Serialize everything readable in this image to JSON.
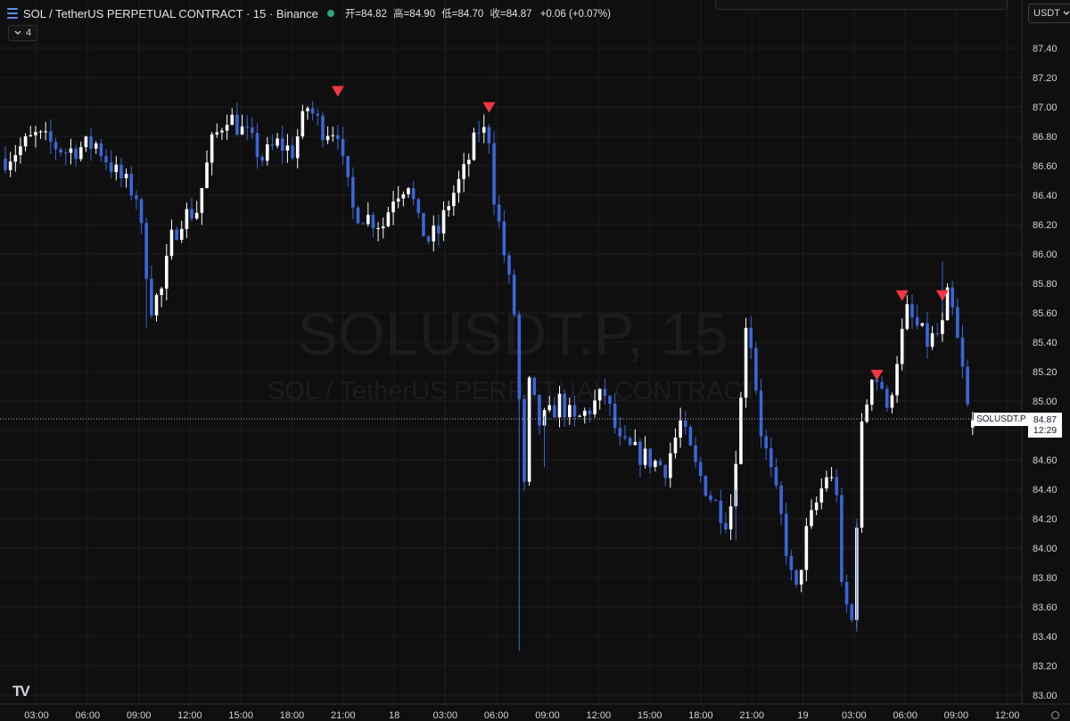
{
  "header": {
    "title": "SOL / TetherUS PERPETUAL CONTRACT · 15 · Binance",
    "open_label": "开",
    "open": "=84.82",
    "high_label": "高",
    "high": "=84.90",
    "low_label": "低",
    "low": "=84.70",
    "close_label": "收",
    "close": "=84.87",
    "change": "+0.06 (+0.07%)"
  },
  "indicator_toggle": {
    "count": "4",
    "chevron": "chevron-down-icon"
  },
  "currency": {
    "label": "USDT",
    "chevron": "chevron-down-icon"
  },
  "watermark": {
    "line1": "SOLUSDT.P, 15",
    "line2": "SOL / TetherUS PERPETUAL CONTRACT"
  },
  "last_price": {
    "symbol": "SOLUSDT.P",
    "price": "84.87",
    "countdown": "12:29"
  },
  "logo": "TV",
  "colors": {
    "background": "#0f0f0f",
    "up": "#ffffff",
    "down": "#3b66d9",
    "signal": "#f23645",
    "grid": "#1c1c1c",
    "axis_text": "#d1d4dc"
  },
  "chart_data": {
    "type": "candlestick",
    "interval_minutes": 15,
    "ylim": [
      83.0,
      87.6
    ],
    "y_ticks": [
      "87.40",
      "87.20",
      "87.00",
      "86.80",
      "86.60",
      "86.40",
      "86.20",
      "86.00",
      "85.80",
      "85.60",
      "85.40",
      "85.20",
      "85.00",
      "84.80",
      "84.60",
      "84.40",
      "84.20",
      "84.00",
      "83.80",
      "83.60",
      "83.40",
      "83.20",
      "83.00"
    ],
    "x_ticks": [
      "03:00",
      "06:00",
      "09:00",
      "12:00",
      "15:00",
      "18:00",
      "21:00",
      "18",
      "03:00",
      "06:00",
      "09:00",
      "12:00",
      "15:00",
      "18:00",
      "21:00",
      "19",
      "03:00",
      "06:00",
      "09:00",
      "12:00"
    ],
    "last_close": 84.87,
    "close_path": [
      [
        0,
        86.65
      ],
      [
        6,
        86.8
      ],
      [
        12,
        86.7
      ],
      [
        18,
        86.75
      ],
      [
        22,
        86.55
      ],
      [
        26,
        86.4
      ],
      [
        28,
        85.9
      ],
      [
        29,
        85.65
      ],
      [
        31,
        85.75
      ],
      [
        33,
        86.1
      ],
      [
        35,
        86.25
      ],
      [
        38,
        86.3
      ],
      [
        41,
        86.75
      ],
      [
        44,
        86.95
      ],
      [
        48,
        86.8
      ],
      [
        51,
        86.65
      ],
      [
        54,
        86.75
      ],
      [
        57,
        86.7
      ],
      [
        60,
        87.0
      ],
      [
        63,
        86.85
      ],
      [
        66,
        86.85
      ],
      [
        67,
        86.6
      ],
      [
        69,
        86.3
      ],
      [
        72,
        86.25
      ],
      [
        75,
        86.2
      ],
      [
        77,
        86.4
      ],
      [
        80,
        86.5
      ],
      [
        82,
        86.2
      ],
      [
        84,
        86.1
      ],
      [
        86,
        86.15
      ],
      [
        88,
        86.35
      ],
      [
        91,
        86.55
      ],
      [
        94,
        86.85
      ],
      [
        96,
        86.8
      ],
      [
        97,
        86.4
      ],
      [
        99,
        86.0
      ],
      [
        101,
        85.6
      ],
      [
        102,
        85.0
      ],
      [
        103,
        84.4
      ],
      [
        104,
        85.1
      ],
      [
        106,
        84.85
      ],
      [
        108,
        84.9
      ],
      [
        110,
        85.0
      ],
      [
        113,
        84.85
      ],
      [
        116,
        84.95
      ],
      [
        119,
        85.05
      ],
      [
        122,
        84.7
      ],
      [
        125,
        84.65
      ],
      [
        128,
        84.6
      ],
      [
        131,
        84.55
      ],
      [
        134,
        84.85
      ],
      [
        137,
        84.55
      ],
      [
        140,
        84.35
      ],
      [
        141,
        84.3
      ],
      [
        143,
        84.2
      ],
      [
        144,
        84.3
      ],
      [
        146,
        85.0
      ],
      [
        147,
        85.55
      ],
      [
        148,
        85.4
      ],
      [
        150,
        84.8
      ],
      [
        152,
        84.5
      ],
      [
        154,
        84.2
      ],
      [
        155,
        84.0
      ],
      [
        156,
        83.8
      ],
      [
        157,
        83.7
      ],
      [
        159,
        84.1
      ],
      [
        161,
        84.3
      ],
      [
        163,
        84.5
      ],
      [
        165,
        84.4
      ],
      [
        166,
        83.7
      ],
      [
        168,
        83.5
      ],
      [
        169,
        84.2
      ],
      [
        170,
        84.8
      ],
      [
        172,
        85.2
      ],
      [
        174,
        85.1
      ],
      [
        175,
        84.9
      ],
      [
        177,
        85.3
      ],
      [
        179,
        85.6
      ],
      [
        181,
        85.5
      ],
      [
        183,
        85.4
      ],
      [
        185,
        85.45
      ],
      [
        186,
        85.5
      ],
      [
        187,
        85.7
      ],
      [
        188,
        85.6
      ],
      [
        189,
        85.4
      ],
      [
        190,
        85.2
      ],
      [
        191,
        84.95
      ],
      [
        192,
        84.87
      ]
    ],
    "sell_signals": [
      {
        "x_bar": 66,
        "price": 87.07
      },
      {
        "x_bar": 96,
        "price": 86.96
      },
      {
        "x_bar": 173,
        "price": 85.14
      },
      {
        "x_bar": 178,
        "price": 85.68
      },
      {
        "x_bar": 186,
        "price": 85.68
      }
    ]
  }
}
